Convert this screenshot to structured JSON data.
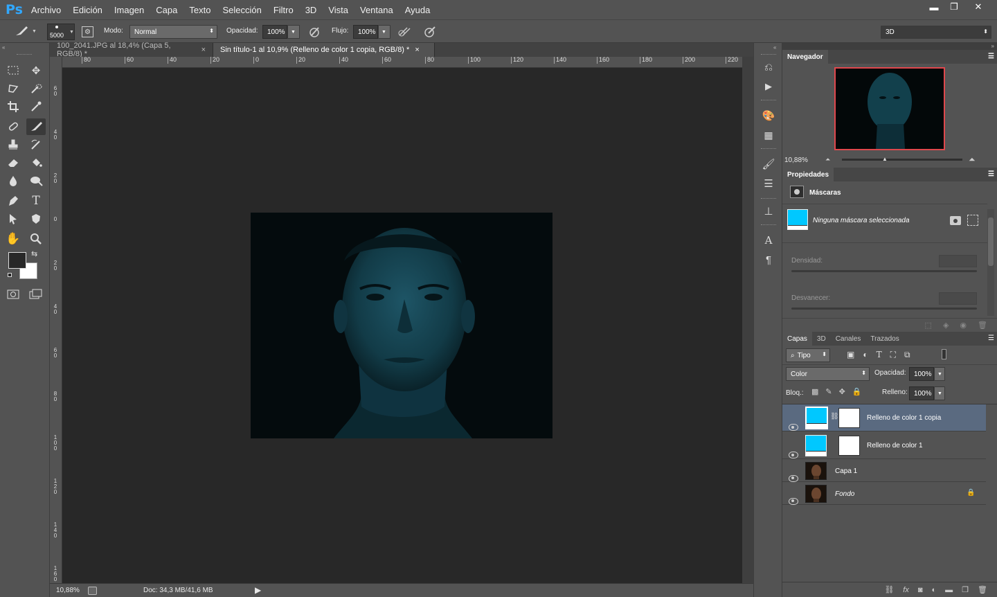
{
  "app": {
    "logo": "Ps"
  },
  "menu": [
    "Archivo",
    "Edición",
    "Imagen",
    "Capa",
    "Texto",
    "Selección",
    "Filtro",
    "3D",
    "Vista",
    "Ventana",
    "Ayuda"
  ],
  "window_controls": {
    "minimize": "▬",
    "restore": "❐",
    "close": "✕"
  },
  "options": {
    "brush_size": "5000",
    "mode_label": "Modo:",
    "mode_value": "Normal",
    "opacity_label": "Opacidad:",
    "opacity_value": "100%",
    "flow_label": "Flujo:",
    "flow_value": "100%",
    "workspace": "3D"
  },
  "tabs": [
    {
      "label": "100_2041.JPG al 18,4% (Capa 5, RGB/8) *",
      "close": "×"
    },
    {
      "label": "Sin título-1 al 10,9% (Relleno de color 1 copia, RGB/8) *",
      "close": "×"
    }
  ],
  "hruler": [
    "80",
    "60",
    "40",
    "20",
    "0",
    "20",
    "40",
    "60",
    "80",
    "100",
    "120",
    "140",
    "160",
    "180",
    "200",
    "220"
  ],
  "vruler": [
    "6 0",
    "4 0",
    "2 0",
    "0",
    "2 0",
    "4 0",
    "6 0",
    "8 0",
    "1 0 0",
    "1 2 0",
    "1 4 0",
    "1 6 0"
  ],
  "status": {
    "zoom": "10,88%",
    "doc": "Doc: 34,3 MB/41,6 MB"
  },
  "navigator": {
    "title": "Navegador",
    "zoom": "10,88%"
  },
  "properties": {
    "title": "Propiedades",
    "section": "Máscaras",
    "no_mask": "Ninguna máscara seleccionada",
    "density_label": "Densidad:",
    "feather_label": "Desvanecer:"
  },
  "layers_panel": {
    "tabs": [
      "Capas",
      "3D",
      "Canales",
      "Trazados"
    ],
    "filter": "Tipo",
    "blend_mode": "Color",
    "opacity_label": "Opacidad:",
    "opacity_value": "100%",
    "lock_label": "Bloq.:",
    "fill_label": "Relleno:",
    "fill_value": "100%",
    "layers": [
      {
        "name": "Relleno de color 1 copia",
        "type": "fill",
        "selected": true
      },
      {
        "name": "Relleno de color 1",
        "type": "fill",
        "selected": false
      },
      {
        "name": "Capa 1",
        "type": "image",
        "selected": false
      },
      {
        "name": "Fondo",
        "type": "image",
        "selected": false,
        "locked": true
      }
    ]
  },
  "colors": {
    "accent": "#31a8ff",
    "fill_color": "#00c8ff",
    "canvas_bg": "#282828",
    "panel": "#535353",
    "navigator_frame": "#e0474c"
  }
}
